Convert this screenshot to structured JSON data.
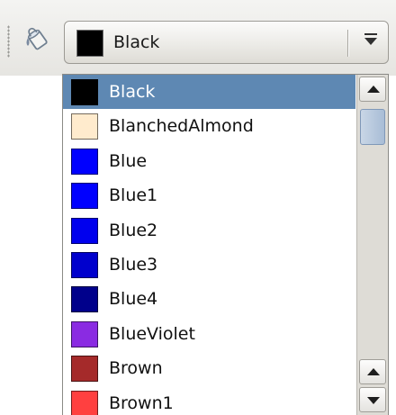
{
  "toolbar": {
    "fill_icon_name": "paint-bucket-icon",
    "combo": {
      "selected_label": "Black",
      "selected_color": "#000000",
      "arrow_icon": "chevron-down-icon"
    }
  },
  "dropdown": {
    "selected_index": 0,
    "items": [
      {
        "label": "Black",
        "color": "#000000"
      },
      {
        "label": "BlanchedAlmond",
        "color": "#FFEBCD"
      },
      {
        "label": "Blue",
        "color": "#0000FF"
      },
      {
        "label": "Blue1",
        "color": "#0000FF"
      },
      {
        "label": "Blue2",
        "color": "#0000EE"
      },
      {
        "label": "Blue3",
        "color": "#0000CD"
      },
      {
        "label": "Blue4",
        "color": "#00008B"
      },
      {
        "label": "BlueViolet",
        "color": "#8A2BE2"
      },
      {
        "label": "Brown",
        "color": "#A52A2A"
      },
      {
        "label": "Brown1",
        "color": "#FF4040"
      }
    ]
  },
  "colors": {
    "selection": "#5e88b3",
    "scroll_thumb": "#a8bdd6"
  }
}
